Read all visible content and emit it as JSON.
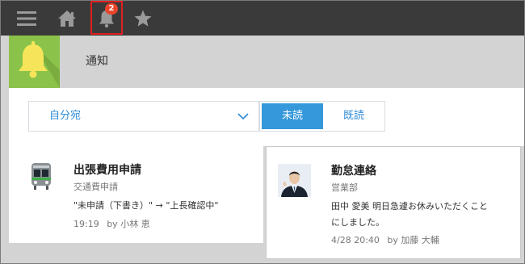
{
  "topbar": {
    "menu_icon": "hamburger-icon",
    "home_icon": "home-icon",
    "bell_icon": "bell-icon",
    "star_icon": "star-icon",
    "badge_count": "2",
    "highlight_color": "#e02020"
  },
  "header": {
    "title": "通知",
    "tile_color": "#8bc34a"
  },
  "filters": {
    "recipient_selected": "自分宛",
    "tab_unread": "未読",
    "tab_read": "既読",
    "active_color": "#3498db"
  },
  "notifications": [
    {
      "icon": "train-icon",
      "title": "出張費用申請",
      "category": "交通費申請",
      "message": "\"未申請（下書き）\" → \"上長確認中\"",
      "time": "19:19",
      "by": "by 小林 恵"
    },
    {
      "icon": "avatar",
      "title": "勤怠連絡",
      "category": "営業部",
      "message_line1": "田中 愛美 明日急遽お休みいただくこと",
      "message_line2": "にしました。",
      "time": "4/28 20:40",
      "by": "by 加藤 大輔"
    }
  ]
}
